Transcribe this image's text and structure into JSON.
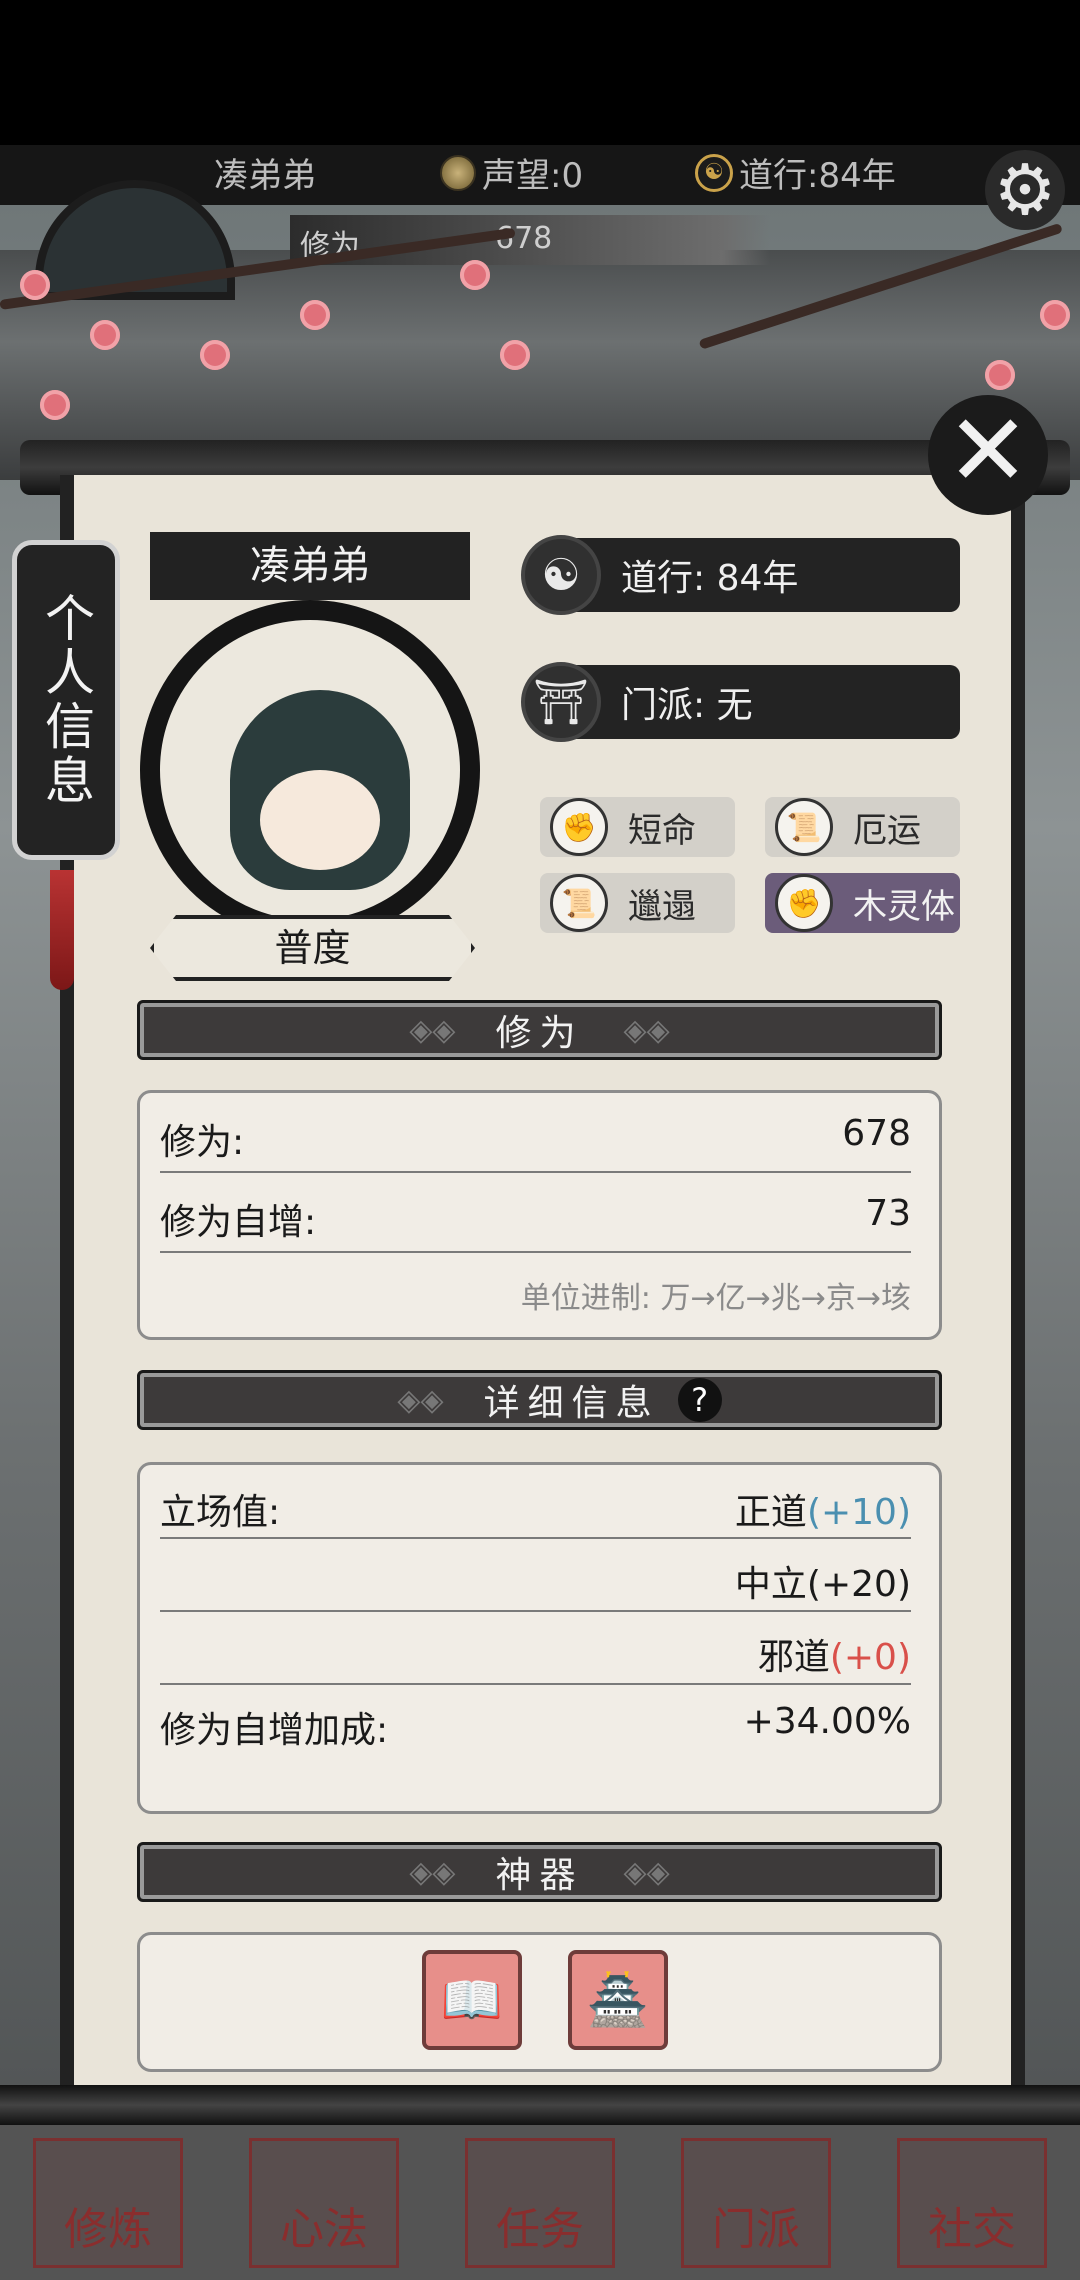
{
  "top": {
    "name": "凑弟弟",
    "reputation": "声望:0",
    "daoxing": "道行:84年"
  },
  "mini": {
    "label1": "修为",
    "value1": "678"
  },
  "side_tab": "个人信息",
  "profile": {
    "name": "凑弟弟",
    "title": "普度",
    "daoxing": "道行: 84年",
    "sect": "门派: 无",
    "traits": [
      "短命",
      "厄运",
      "邋遢",
      "木灵体"
    ]
  },
  "cultivation": {
    "header": "修为",
    "rows": [
      {
        "label": "修为:",
        "value": "678"
      },
      {
        "label": "修为自增:",
        "value": "73"
      }
    ],
    "unit_note": "单位进制: 万→亿→兆→京→垓"
  },
  "details": {
    "header": "详细信息",
    "help": "?",
    "stance_label": "立场值:",
    "stance": [
      {
        "name": "正道",
        "bonus": "(+10)"
      },
      {
        "name": "中立(+20)",
        "bonus": ""
      },
      {
        "name": "邪道",
        "bonus": "(+0)"
      }
    ],
    "bonus_label": "修为自增加成:",
    "bonus_value": "+34.00%"
  },
  "artifacts": {
    "header": "神器",
    "items": [
      "book-artifact-icon",
      "jade-seal-artifact-icon"
    ]
  },
  "nav": [
    "修炼",
    "心法",
    "任务",
    "门派",
    "社交"
  ],
  "colors": {
    "positive": "#4a8fb0",
    "negative": "#d9504a",
    "special_trait": "#6b5c7a"
  }
}
